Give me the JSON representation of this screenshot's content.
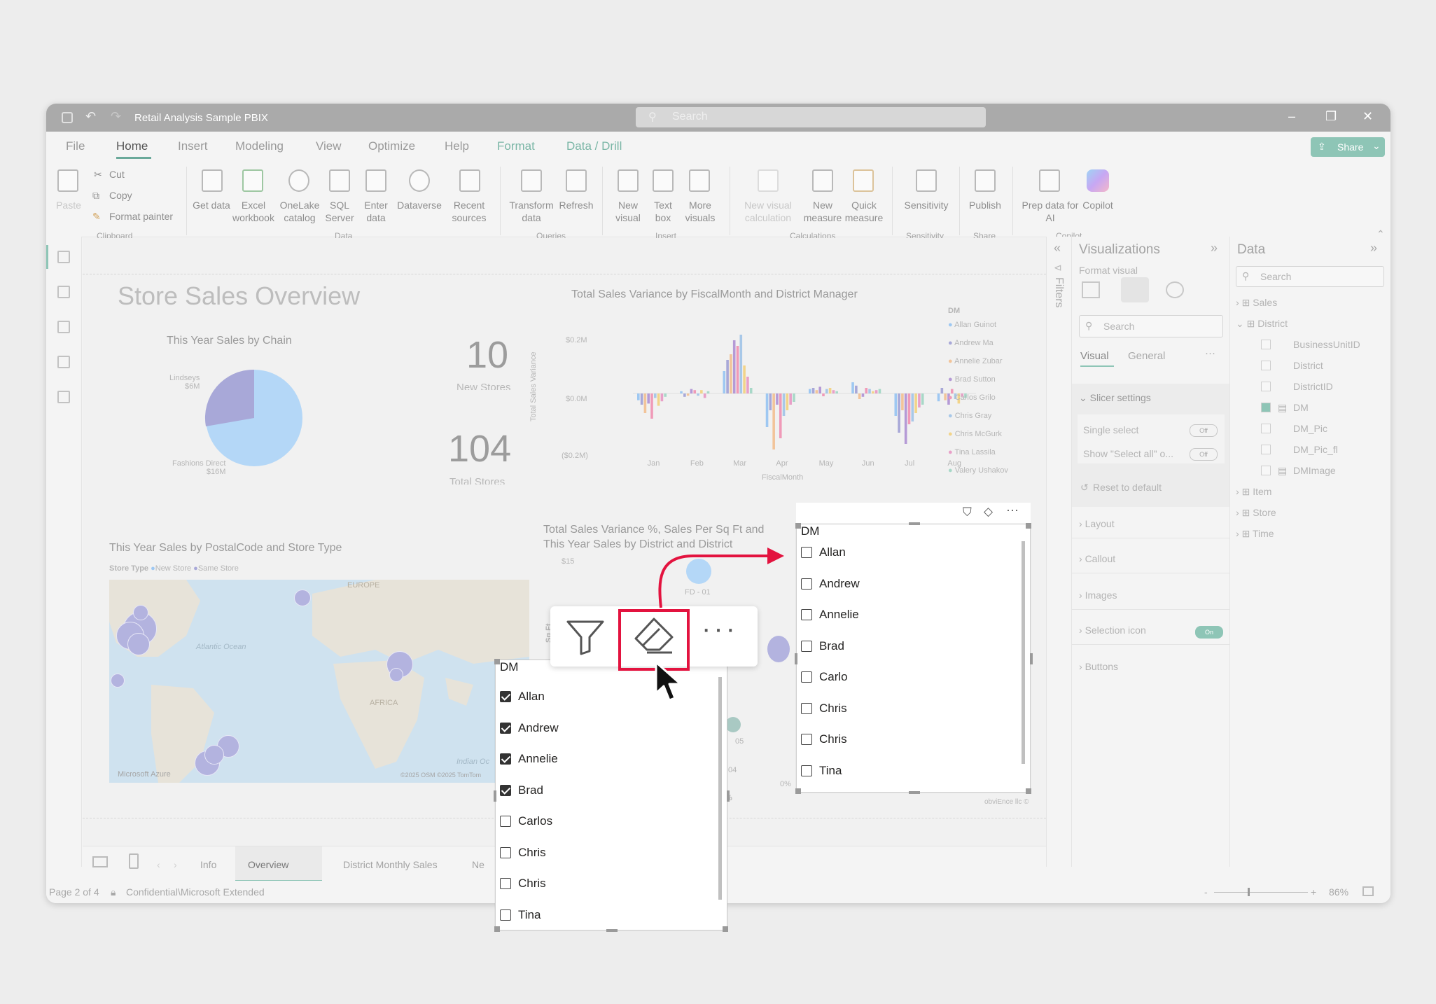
{
  "window": {
    "title": "Retail Analysis Sample PBIX",
    "search_placeholder": "Search"
  },
  "menu": {
    "items": [
      "File",
      "Home",
      "Insert",
      "Modeling",
      "View",
      "Optimize",
      "Help",
      "Format",
      "Data / Drill"
    ],
    "share_label": "Share"
  },
  "ribbon": {
    "paste": "Paste",
    "cut": "Cut",
    "copy": "Copy",
    "format_painter": "Format painter",
    "get_data": "Get data",
    "excel_workbook": "Excel workbook",
    "onelake_catalog": "OneLake catalog",
    "sql_server": "SQL Server",
    "enter_data": "Enter data",
    "dataverse": "Dataverse",
    "recent_sources": "Recent sources",
    "transform_data": "Transform data",
    "refresh": "Refresh",
    "new_visual": "New visual",
    "text_box": "Text box",
    "more_visuals": "More visuals",
    "new_visual_calculation": "New visual calculation",
    "new_measure": "New measure",
    "quick_measure": "Quick measure",
    "sensitivity": "Sensitivity",
    "publish": "Publish",
    "prep_data": "Prep data for AI",
    "copilot": "Copilot",
    "groups": {
      "clipboard": "Clipboard",
      "data": "Data",
      "queries": "Queries",
      "insert": "Insert",
      "calculations": "Calculations",
      "sensitivity": "Sensitivity",
      "share": "Share",
      "copilot": "Copilot"
    }
  },
  "report": {
    "title": "Store Sales Overview",
    "pie": {
      "title": "This Year Sales by Chain",
      "label1": "Lindseys",
      "value1": "$6M",
      "label2": "Fashions Direct",
      "value2": "$16M"
    },
    "kpi1": {
      "value": "10",
      "label": "New Stores"
    },
    "kpi2": {
      "value": "104",
      "label": "Total Stores"
    },
    "variance": {
      "title": "Total Sales Variance by FiscalMonth and District Manager",
      "ylabel": "Total Sales Variance",
      "xlabel": "FiscalMonth",
      "yticks": [
        "$0.2M",
        "$0.0M",
        "($0.2M)"
      ],
      "months": [
        "Jan",
        "Feb",
        "Mar",
        "Apr",
        "May",
        "Jun",
        "Jul",
        "Aug"
      ],
      "legend_title": "DM",
      "legend": [
        "Allan Guinot",
        "Andrew Ma",
        "Annelie Zubar",
        "Brad Sutton",
        "Carlos Grilo",
        "Chris Gray",
        "Chris McGurk",
        "Tina Lassila",
        "Valery Ushakov"
      ]
    },
    "map": {
      "title": "This Year Sales by PostalCode and Store Type",
      "legend_title": "Store Type",
      "legend_new": "New Store",
      "legend_same": "Same Store",
      "atlantic": "Atlantic Ocean",
      "europe": "EUROPE",
      "africa": "AFRICA",
      "indian": "Indian Oc",
      "attribution": "Microsoft Azure",
      "copyright": "©2025 OSM ©2025 TomTom"
    },
    "scatter": {
      "title_line1": "Total Sales Variance %, Sales Per Sq Ft and",
      "title_line2": "This Year Sales by District and District",
      "ytick": "$15",
      "point_label": "FD - 01",
      "label_05": "05",
      "label_04": "04",
      "label_pct": "%",
      "label_0pct": "0%",
      "ylabel": "Sq Ft",
      "label_02": "02"
    },
    "credit": "obviEnce llc ©"
  },
  "slicer_front": {
    "header": "DM",
    "items": [
      {
        "label": "Allan",
        "checked": true
      },
      {
        "label": "Andrew",
        "checked": true
      },
      {
        "label": "Annelie",
        "checked": true
      },
      {
        "label": "Brad",
        "checked": true
      },
      {
        "label": "Carlos",
        "checked": false
      },
      {
        "label": "Chris",
        "checked": false
      },
      {
        "label": "Chris",
        "checked": false
      },
      {
        "label": "Tina",
        "checked": false
      }
    ]
  },
  "slicer_result": {
    "header": "DM",
    "items": [
      {
        "label": "Allan",
        "checked": false
      },
      {
        "label": "Andrew",
        "checked": false
      },
      {
        "label": "Annelie",
        "checked": false
      },
      {
        "label": "Brad",
        "checked": false
      },
      {
        "label": "Carlo",
        "checked": false
      },
      {
        "label": "Chris",
        "checked": false
      },
      {
        "label": "Chris",
        "checked": false
      },
      {
        "label": "Tina",
        "checked": false
      }
    ]
  },
  "highlight_color": "#e3133f",
  "pages": {
    "tabs": [
      "Info",
      "Overview",
      "District Monthly Sales",
      "Ne"
    ],
    "active": "Overview"
  },
  "status": {
    "page": "Page 2 of 4",
    "sensitivity": "Confidential\\Microsoft Extended",
    "zoom": "86%"
  },
  "filters_label": "Filters",
  "visualizations": {
    "title": "Visualizations",
    "format_visual": "Format visual",
    "search": "Search",
    "tab_visual": "Visual",
    "tab_general": "General",
    "slicer_settings": "Slicer settings",
    "single_select": "Single select",
    "single_select_state": "Off",
    "show_select_all": "Show \"Select all\" o...",
    "show_select_all_state": "Off",
    "reset": "Reset to default",
    "sections": [
      "Layout",
      "Callout",
      "Images",
      "Selection icon",
      "Buttons"
    ],
    "selection_icon_state": "On"
  },
  "data_pane": {
    "title": "Data",
    "search": "Search",
    "tables": [
      {
        "name": "Sales"
      },
      {
        "name": "District",
        "fields": [
          "BusinessUnitID",
          "District",
          "DistrictID",
          "DM",
          "DM_Pic",
          "DM_Pic_fl",
          "DMImage"
        ]
      },
      {
        "name": "Item"
      },
      {
        "name": "Store"
      },
      {
        "name": "Time"
      }
    ]
  }
}
